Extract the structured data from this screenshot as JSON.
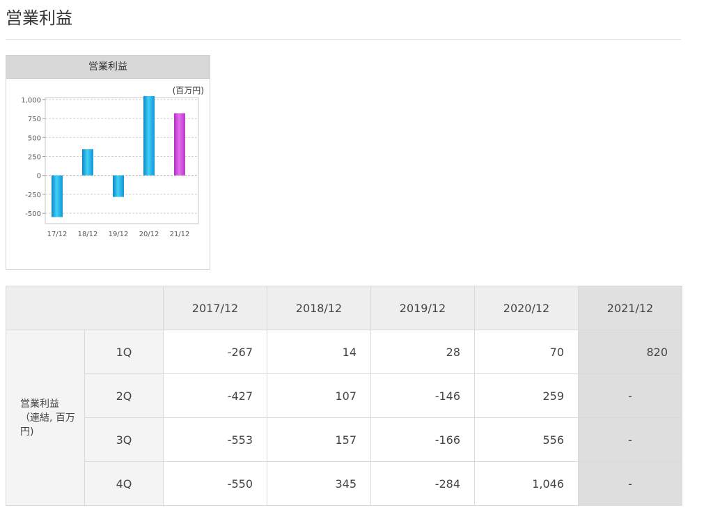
{
  "page": {
    "title": "営業利益"
  },
  "chart_data": {
    "type": "bar",
    "title": "営業利益",
    "unit": "(百万円)",
    "categories": [
      "17/12",
      "18/12",
      "19/12",
      "20/12",
      "21/12"
    ],
    "values": [
      -550,
      345,
      -284,
      1046,
      820
    ],
    "ylim": [
      -600,
      1100
    ],
    "yticks": [
      1000,
      750,
      500,
      250,
      0,
      -250,
      -500
    ],
    "ytick_labels": [
      "1,000",
      "750",
      "500",
      "250",
      "0",
      "-250",
      "-500"
    ],
    "grid": true,
    "colors": [
      "#22b8ea",
      "#22b8ea",
      "#22b8ea",
      "#22b8ea",
      "#d24ad8"
    ]
  },
  "table": {
    "headers": [
      "2017/12",
      "2018/12",
      "2019/12",
      "2020/12",
      "2021/12"
    ],
    "row_label_lines": [
      "営業利益",
      "（連結, 百万",
      "円)"
    ],
    "rows": [
      {
        "quarter": "1Q",
        "values": [
          "-267",
          "14",
          "28",
          "70",
          "820"
        ]
      },
      {
        "quarter": "2Q",
        "values": [
          "-427",
          "107",
          "-146",
          "259",
          "-"
        ]
      },
      {
        "quarter": "3Q",
        "values": [
          "-553",
          "157",
          "-166",
          "556",
          "-"
        ]
      },
      {
        "quarter": "4Q",
        "values": [
          "-550",
          "345",
          "-284",
          "1,046",
          "-"
        ]
      }
    ]
  }
}
